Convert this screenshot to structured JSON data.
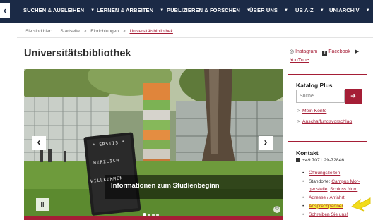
{
  "nav": {
    "back_glyph": "‹",
    "items": [
      {
        "label": "SUCHEN & AUSLEIHEN"
      },
      {
        "label": "LERNEN & ARBEITEN"
      },
      {
        "label": "PUBLIZIEREN & FORSCHEN"
      },
      {
        "label": "ÜBER UNS"
      },
      {
        "label": "UB A-Z"
      },
      {
        "label": "UNIARCHIV"
      }
    ],
    "caret": "▼"
  },
  "breadcrumb": {
    "prefix": "Sie sind hier:",
    "items": [
      "Startseite",
      "Einrichtungen",
      "Universitätsbibliothek"
    ],
    "separator": ">"
  },
  "page": {
    "title": "Universitätsbibliothek"
  },
  "social": {
    "instagram": "Instagram",
    "facebook": "Facebook",
    "youtube": "YouTube",
    "fb_glyph": "f"
  },
  "slider": {
    "caption": "Informationen zum Studienbeginn",
    "sign_text": [
      "* ERSTIS *",
      "HERZLICH",
      "WILLKOMMEN"
    ],
    "prev_glyph": "‹",
    "next_glyph": "›",
    "pause_glyph": "II",
    "copyright_glyph": "©",
    "dot_count": 4,
    "active_dot": 1
  },
  "katalog": {
    "title": "Katalog Plus",
    "search_placeholder": "Suche",
    "search_button_glyph": "➔",
    "links": [
      {
        "chevron": ">",
        "label": "Mein Konto"
      },
      {
        "chevron": ">",
        "label": "Anschaffungsvorschlag"
      }
    ]
  },
  "kontakt": {
    "title": "Kontakt",
    "phone": "+49 7071 29-72846",
    "items": [
      {
        "label": "Öffnungszeiten"
      },
      {
        "prefix": "Standorte: ",
        "label": "Campus Mor-genstelle",
        "separator": ", ",
        "label2": "Schloss Nord"
      },
      {
        "label": "Adresse / Anfahrt"
      },
      {
        "label": "Ansprechpartner",
        "highlighted": true
      },
      {
        "label": "Schreiben Sie uns!"
      }
    ]
  },
  "colors": {
    "nav_bg": "#1b2a46",
    "accent": "#a51e36",
    "highlight": "#f8f33a"
  }
}
